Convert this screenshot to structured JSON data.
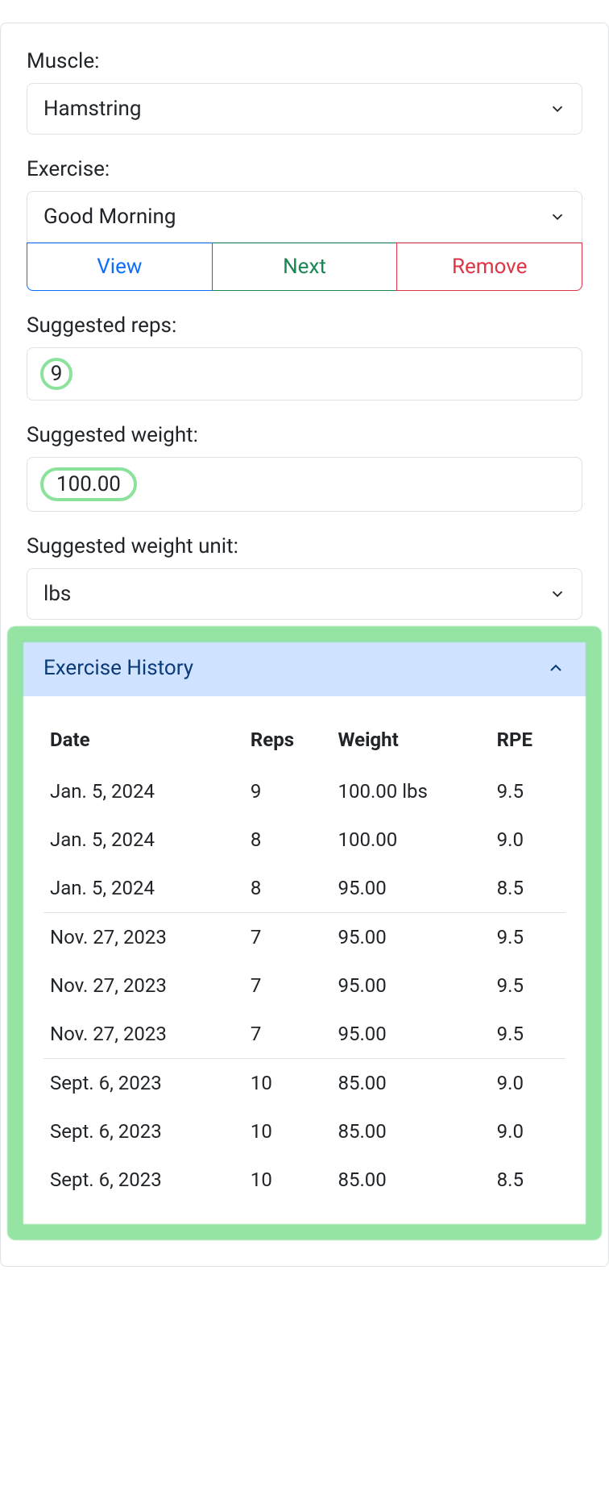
{
  "labels": {
    "muscle": "Muscle:",
    "exercise": "Exercise:",
    "suggested_reps": "Suggested reps:",
    "suggested_weight": "Suggested weight:",
    "suggested_weight_unit": "Suggested weight unit:"
  },
  "muscle": {
    "selected": "Hamstring"
  },
  "exercise": {
    "selected": "Good Morning",
    "buttons": {
      "view": "View",
      "next": "Next",
      "remove": "Remove"
    }
  },
  "suggested": {
    "reps": "9",
    "weight": "100.00",
    "unit": "lbs"
  },
  "history": {
    "title": "Exercise History",
    "columns": {
      "date": "Date",
      "reps": "Reps",
      "weight": "Weight",
      "rpe": "RPE"
    },
    "groups": [
      [
        {
          "date": "Jan. 5, 2024",
          "reps": "9",
          "weight": "100.00 lbs",
          "rpe": "9.5"
        },
        {
          "date": "Jan. 5, 2024",
          "reps": "8",
          "weight": "100.00",
          "rpe": "9.0"
        },
        {
          "date": "Jan. 5, 2024",
          "reps": "8",
          "weight": "95.00",
          "rpe": "8.5"
        }
      ],
      [
        {
          "date": "Nov. 27, 2023",
          "reps": "7",
          "weight": "95.00",
          "rpe": "9.5"
        },
        {
          "date": "Nov. 27, 2023",
          "reps": "7",
          "weight": "95.00",
          "rpe": "9.5"
        },
        {
          "date": "Nov. 27, 2023",
          "reps": "7",
          "weight": "95.00",
          "rpe": "9.5"
        }
      ],
      [
        {
          "date": "Sept. 6, 2023",
          "reps": "10",
          "weight": "85.00",
          "rpe": "9.0"
        },
        {
          "date": "Sept. 6, 2023",
          "reps": "10",
          "weight": "85.00",
          "rpe": "9.0"
        },
        {
          "date": "Sept. 6, 2023",
          "reps": "10",
          "weight": "85.00",
          "rpe": "8.5"
        }
      ]
    ]
  }
}
